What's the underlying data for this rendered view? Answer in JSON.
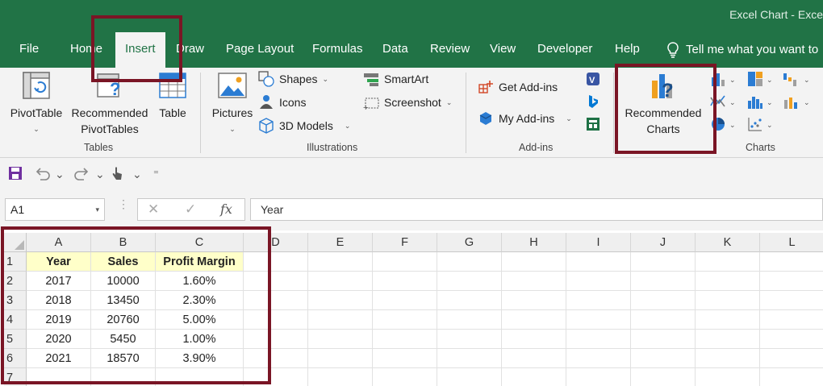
{
  "window": {
    "title": "Excel Chart  -  Exce"
  },
  "tabs": [
    {
      "label": "File"
    },
    {
      "label": "Home"
    },
    {
      "label": "Insert",
      "active": true
    },
    {
      "label": "Draw"
    },
    {
      "label": "Page Layout"
    },
    {
      "label": "Formulas"
    },
    {
      "label": "Data"
    },
    {
      "label": "Review"
    },
    {
      "label": "View"
    },
    {
      "label": "Developer"
    },
    {
      "label": "Help"
    }
  ],
  "tell_me": {
    "label": "Tell me what you want to"
  },
  "ribbon": {
    "tables": {
      "group_label": "Tables",
      "pivottable": "PivotTable",
      "recommended_pivottables_line1": "Recommended",
      "recommended_pivottables_line2": "PivotTables",
      "table": "Table"
    },
    "illustrations": {
      "group_label": "Illustrations",
      "pictures": "Pictures",
      "shapes": "Shapes",
      "icons": "Icons",
      "models_3d": "3D Models",
      "smartart": "SmartArt",
      "screenshot": "Screenshot"
    },
    "addins": {
      "group_label": "Add-ins",
      "get_addins": "Get Add-ins",
      "my_addins": "My Add-ins"
    },
    "charts": {
      "group_label": "Charts",
      "recommended_line1": "Recommended",
      "recommended_line2": "Charts"
    }
  },
  "formula_bar": {
    "name_box": "A1",
    "formula": "Year"
  },
  "sheet": {
    "columns": [
      "A",
      "B",
      "C",
      "D",
      "E",
      "F",
      "G",
      "H",
      "I",
      "J",
      "K",
      "L"
    ],
    "rows": [
      "1",
      "2",
      "3",
      "4",
      "5",
      "6",
      "7"
    ],
    "headers": [
      "Year",
      "Sales",
      "Profit Margin"
    ],
    "data": [
      [
        "2017",
        "10000",
        "1.60%"
      ],
      [
        "2018",
        "13450",
        "2.30%"
      ],
      [
        "2019",
        "20760",
        "5.00%"
      ],
      [
        "2020",
        "5450",
        "1.00%"
      ],
      [
        "2021",
        "18570",
        "3.90%"
      ]
    ]
  },
  "colors": {
    "excel_green": "#217346",
    "highlight": "#7a1525",
    "header_fill": "#ffffc9"
  }
}
